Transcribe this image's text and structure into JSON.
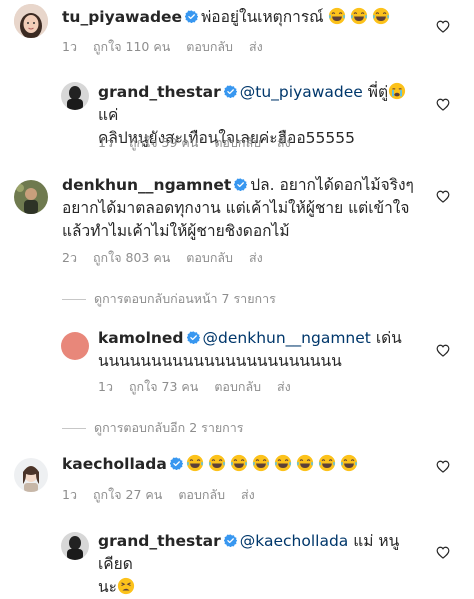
{
  "comments": [
    {
      "username": "tu_piyawadee",
      "body": "พ่ออยู่ในเหตุการณ์",
      "emojis": [
        "laugh",
        "laugh",
        "laugh"
      ],
      "time": "1ว",
      "likes": "ถูกใจ 110 คน",
      "reply": "ตอบกลับ",
      "send": "ส่ง"
    },
    {
      "username": "grand_thestar",
      "mention": "@tu_piyawadee",
      "body_line1": "พี่ตู่",
      "body_line1_tail": "แค่",
      "body_line2": "คลิปหนูยังสะเทือนใจเลยค่ะฮืออ55555",
      "emoji_inline": "crying",
      "time": "1ว",
      "likes": "ถูกใจ 59 คน",
      "reply": "ตอบกลับ",
      "send": "ส่ง"
    },
    {
      "username": "denkhun__ngamnet",
      "body_line1": "ปล. อยากได้ดอกไม้จริงๆ",
      "body_line2": "อยากได้มาตลอดทุกงาน แต่เค้าไม่ให้ผู้ชาย แต่เข้าใจ",
      "body_line3": "แล้วทำไมเค้าไม่ให้ผู้ชายชิงดอกไม้",
      "time": "2ว",
      "likes": "ถูกใจ 803 คน",
      "reply": "ตอบกลับ",
      "send": "ส่ง"
    },
    {
      "username": "kamolned",
      "mention": "@denkhun__ngamnet",
      "body_line1_tail": "เด่น",
      "body_line2": "นนนนนนนนนนนนนนนนนนนนนนน",
      "time": "1ว",
      "likes": "ถูกใจ 73 คน",
      "reply": "ตอบกลับ",
      "send": "ส่ง"
    },
    {
      "username": "kaechollada",
      "emojis": [
        "laugh",
        "laugh",
        "laugh",
        "laugh",
        "laugh",
        "laugh",
        "laugh",
        "laugh"
      ],
      "time": "1ว",
      "likes": "ถูกใจ 27 คน",
      "reply": "ตอบกลับ",
      "send": "ส่ง"
    },
    {
      "username": "grand_thestar",
      "mention": "@kaechollada",
      "body_line1_tail": "แม่ หนูเคียด",
      "body_line2": "นะ",
      "emoji_inline": "tired"
    }
  ],
  "view_prev_replies": "ดูการตอบกลับก่อนหน้า 7 รายการ",
  "view_more_replies": "ดูการตอบกลับอีก 2 รายการ",
  "colors": {
    "text": "#262626",
    "meta": "#8e8e8e",
    "mention": "#00376b",
    "verified": "#3897f0",
    "kamolned_avatar": "#e8877a"
  }
}
